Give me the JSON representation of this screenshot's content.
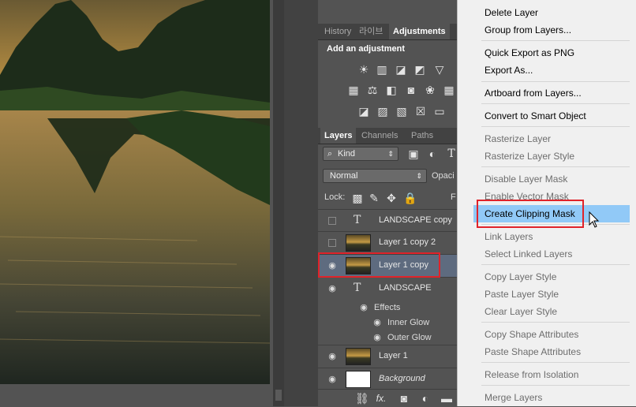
{
  "adjustments_panel": {
    "tabs": [
      "History",
      "라이브",
      "Adjustments"
    ],
    "active_tab": "Adjustments",
    "title": "Add an adjustment",
    "icons_row1": [
      "brightness-contrast-icon",
      "levels-icon",
      "curves-icon",
      "exposure-icon",
      "vibrance-icon"
    ],
    "icons_row2": [
      "hue-saturation-icon",
      "color-balance-icon",
      "black-white-icon",
      "photo-filter-icon",
      "channel-mixer-icon",
      "color-lookup-icon"
    ],
    "icons_row3": [
      "invert-icon",
      "posterize-icon",
      "threshold-icon",
      "selective-color-icon",
      "gradient-map-icon"
    ]
  },
  "layers_panel": {
    "tabs": [
      "Layers",
      "Channels",
      "Paths"
    ],
    "active_tab": "Layers",
    "filter_kind": "Kind",
    "blend_mode": "Normal",
    "opacity_label": "Opaci",
    "lock_label": "Lock:",
    "fill_label": "F",
    "layers": [
      {
        "name": "LANDSCAPE copy",
        "type": "text",
        "visible": false
      },
      {
        "name": "Layer 1 copy 2",
        "type": "image",
        "visible": false
      },
      {
        "name": "Layer 1 copy",
        "type": "image",
        "visible": true,
        "selected": true
      },
      {
        "name": "LANDSCAPE",
        "type": "text",
        "visible": true
      },
      {
        "name": "Layer 1",
        "type": "image",
        "visible": true
      },
      {
        "name": "Background",
        "type": "white",
        "visible": true
      }
    ],
    "effects_label": "Effects",
    "effects": [
      "Inner Glow",
      "Outer Glow"
    ],
    "footer_icons": [
      "link-icon",
      "fx-icon",
      "mask-icon",
      "adjustment-icon",
      "folder-icon"
    ],
    "footer_fx": "fx."
  },
  "context_menu": {
    "items": [
      {
        "label": "Delete Layer",
        "enabled": true
      },
      {
        "label": "Group from Layers...",
        "enabled": true
      },
      {
        "label": "Quick Export as PNG",
        "enabled": true
      },
      {
        "label": "Export As...",
        "enabled": true
      },
      {
        "label": "Artboard from Layers...",
        "enabled": true
      },
      {
        "label": "Convert to Smart Object",
        "enabled": true
      },
      {
        "label": "Rasterize Layer",
        "enabled": false
      },
      {
        "label": "Rasterize Layer Style",
        "enabled": false
      },
      {
        "label": "Disable Layer Mask",
        "enabled": false
      },
      {
        "label": "Enable Vector Mask",
        "enabled": false
      },
      {
        "label": "Create Clipping Mask",
        "enabled": true,
        "highlighted": true
      },
      {
        "label": "Link Layers",
        "enabled": false
      },
      {
        "label": "Select Linked Layers",
        "enabled": false
      },
      {
        "label": "Copy Layer Style",
        "enabled": false
      },
      {
        "label": "Paste Layer Style",
        "enabled": false
      },
      {
        "label": "Clear Layer Style",
        "enabled": false
      },
      {
        "label": "Copy Shape Attributes",
        "enabled": false
      },
      {
        "label": "Paste Shape Attributes",
        "enabled": false
      },
      {
        "label": "Release from Isolation",
        "enabled": false
      },
      {
        "label": "Merge Layers",
        "enabled": false
      }
    ]
  },
  "colors": {
    "panel_bg": "#535353",
    "selected_row": "#5e6b7f",
    "menu_highlight": "#91c9f7",
    "annotation_red": "#e0232a"
  }
}
